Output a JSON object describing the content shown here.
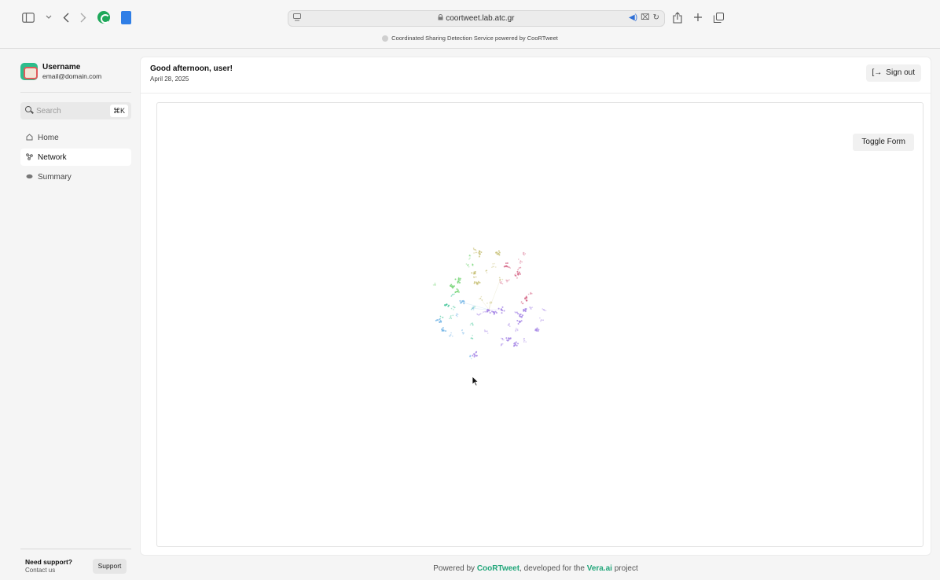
{
  "browser": {
    "url": "coortweet.lab.atc.gr",
    "tab_title": "Coordinated Sharing Detection Service powered by CooRTweet",
    "icons": [
      "sidebar-icon",
      "back-icon",
      "forward-icon",
      "grammarly-extension-icon",
      "notes-extension-icon",
      "lock-icon",
      "audio-icon",
      "translate-icon",
      "reload-icon",
      "share-icon",
      "new-tab-icon",
      "tabs-overview-icon"
    ]
  },
  "sidebar": {
    "profile": {
      "name": "Username",
      "email": "email@domain.com"
    },
    "search": {
      "placeholder": "Search",
      "shortcut": "⌘K"
    },
    "items": [
      {
        "label": "Home",
        "icon": "home-icon",
        "active": false
      },
      {
        "label": "Network",
        "icon": "network-icon",
        "active": true
      },
      {
        "label": "Summary",
        "icon": "summary-icon",
        "active": false
      }
    ],
    "support": {
      "title": "Need support?",
      "subtitle": "Contact us",
      "button": "Support"
    }
  },
  "header": {
    "greeting": "Good afternoon, user!",
    "date": "April 28, 2025",
    "sign_out": "Sign out"
  },
  "network": {
    "toggle_label": "Toggle Form",
    "cluster_colors": [
      "#7ad67a",
      "#4fc9a0",
      "#7ab8e8",
      "#a889e6",
      "#d66a8a",
      "#c9c27a"
    ]
  },
  "footer": {
    "prefix": "Powered by ",
    "brand1": "CooRTweet",
    "middle": ", developed for the ",
    "brand2": "Vera.ai",
    "suffix": " project"
  },
  "colors": {
    "accent": "#22a67a"
  }
}
